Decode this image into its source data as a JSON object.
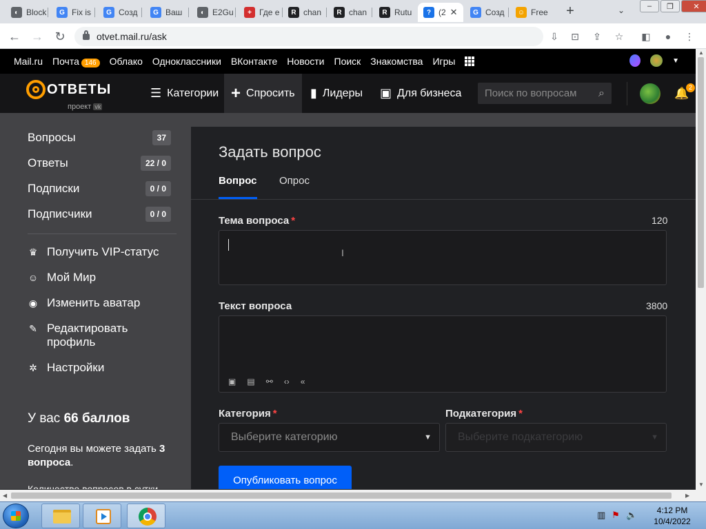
{
  "browser": {
    "tabs": [
      {
        "label": "Block",
        "fav_color": "#5f6368",
        "fav_glyph": "◐"
      },
      {
        "label": "Fix is",
        "fav_color": "#4285f4",
        "fav_glyph": "G"
      },
      {
        "label": "Созд",
        "fav_color": "#4285f4",
        "fav_glyph": "G"
      },
      {
        "label": "Ваш",
        "fav_color": "#4285f4",
        "fav_glyph": "G"
      },
      {
        "label": "E2Gu",
        "fav_color": "#5f6368",
        "fav_glyph": "◐"
      },
      {
        "label": "Где е",
        "fav_color": "#d32f2f",
        "fav_glyph": "+"
      },
      {
        "label": "chan",
        "fav_color": "#202124",
        "fav_glyph": "R"
      },
      {
        "label": "chan",
        "fav_color": "#202124",
        "fav_glyph": "R"
      },
      {
        "label": "Rutu",
        "fav_color": "#202124",
        "fav_glyph": "R"
      },
      {
        "label": "(2",
        "fav_color": "#1a73e8",
        "fav_glyph": "?"
      },
      {
        "label": "Созд",
        "fav_color": "#4285f4",
        "fav_glyph": "G"
      },
      {
        "label": "Free",
        "fav_color": "#f4a300",
        "fav_glyph": "☺"
      }
    ],
    "active_tab_close": "✕",
    "new_tab": "+",
    "tab_menu": "⌄",
    "url": "otvet.mail.ru/ask"
  },
  "portal": {
    "links": [
      "Mail.ru",
      "Почта",
      "Облако",
      "Одноклассники",
      "ВКонтакте",
      "Новости",
      "Поиск",
      "Знакомства",
      "Игры"
    ],
    "mail_badge": "146"
  },
  "header": {
    "logo_word": "ОТВЕТЫ",
    "logo_sub": "проект",
    "logo_sub_badge": "vk",
    "nav": [
      {
        "icon": "☰",
        "label": "Категории"
      },
      {
        "icon": "+",
        "label": "Спросить"
      },
      {
        "icon": "▮",
        "label": "Лидеры"
      },
      {
        "icon": "▣",
        "label": "Для бизнеса"
      }
    ],
    "search_placeholder": "Поиск по вопросам",
    "bell_badge": "2"
  },
  "sidebar": {
    "stats": [
      {
        "label": "Вопросы",
        "count": "37"
      },
      {
        "label": "Ответы",
        "count": "22 / 0"
      },
      {
        "label": "Подписки",
        "count": "0 / 0"
      },
      {
        "label": "Подписчики",
        "count": "0 / 0"
      }
    ],
    "links": [
      {
        "icon": "♛",
        "label": "Получить VIP-статус"
      },
      {
        "icon": "☺",
        "label": "Мой Мир"
      },
      {
        "icon": "◉",
        "label": "Изменить аватар"
      },
      {
        "icon": "✎",
        "label": "Редактировать профиль"
      },
      {
        "icon": "✲",
        "label": "Настройки"
      }
    ],
    "points_prefix": "У вас",
    "points_value": "66 баллов",
    "today_text": "Сегодня вы можете задать",
    "today_value": "3 вопроса",
    "today_suffix": ".",
    "quota_text": "Количество вопросов в сутки"
  },
  "main": {
    "title": "Задать вопрос",
    "tabs": [
      "Вопрос",
      "Опрос"
    ],
    "topic_label": "Тема вопроса",
    "topic_limit": "120",
    "topic_value": "",
    "text_label": "Текст вопроса",
    "text_limit": "3800",
    "text_value": "",
    "editor_tools": [
      "▣",
      "▤",
      "⚯",
      "‹›",
      "«"
    ],
    "category_label": "Категория",
    "category_placeholder": "Выберите категорию",
    "subcategory_label": "Подкатегория",
    "subcategory_placeholder": "Выберите подкатегорию",
    "required_mark": "*",
    "publish_label": "Опубликовать вопрос"
  },
  "taskbar": {
    "time": "4:12 PM",
    "date": "10/4/2022"
  }
}
